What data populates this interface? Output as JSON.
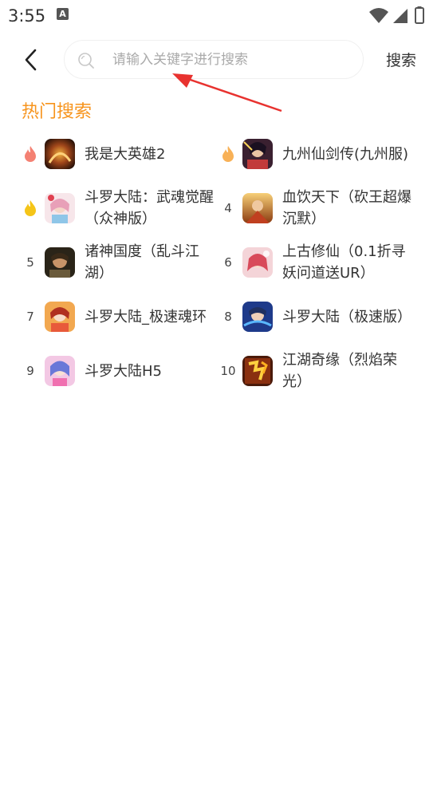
{
  "status_bar": {
    "time": "3:55",
    "notification_icon": "a-notification-icon",
    "right_icons": [
      "wifi-icon",
      "signal-icon",
      "battery-icon"
    ]
  },
  "header": {
    "back_icon": "chevron-left-icon",
    "search_placeholder": "请输入关键字进行搜索",
    "search_value": "",
    "search_button": "搜索"
  },
  "section": {
    "title": "热门搜索"
  },
  "hot_searches": [
    {
      "rank": "",
      "rank_icon": "flame-icon-red",
      "name": "我是大英雄2"
    },
    {
      "rank": "",
      "rank_icon": "flame-icon-orange",
      "name": "九州仙剑传(九州服)"
    },
    {
      "rank": "",
      "rank_icon": "flame-icon-yellow",
      "name": "斗罗大陆：武魂觉醒（众神版）"
    },
    {
      "rank": "4",
      "rank_icon": "",
      "name": "血饮天下（砍王超爆沉默）"
    },
    {
      "rank": "5",
      "rank_icon": "",
      "name": "诸神国度（乱斗江湖）"
    },
    {
      "rank": "6",
      "rank_icon": "",
      "name": "上古修仙（0.1折寻妖问道送UR）"
    },
    {
      "rank": "7",
      "rank_icon": "",
      "name": "斗罗大陆_极速魂环"
    },
    {
      "rank": "8",
      "rank_icon": "",
      "name": "斗罗大陆（极速版）"
    },
    {
      "rank": "9",
      "rank_icon": "",
      "name": "斗罗大陆H5"
    },
    {
      "rank": "10",
      "rank_icon": "",
      "name": "江湖奇缘（烈焰荣光）"
    }
  ],
  "colors": {
    "accent": "#f7941d",
    "flame_red": "#f26b5b",
    "flame_orange": "#f7a845",
    "flame_yellow": "#f5c518",
    "annotation_arrow": "#e8322f"
  }
}
